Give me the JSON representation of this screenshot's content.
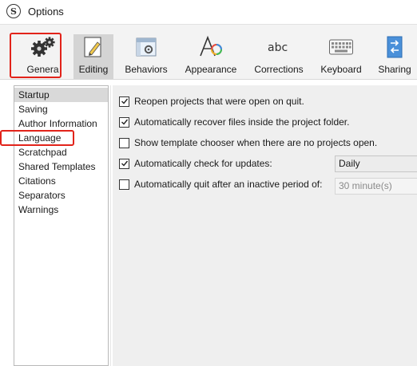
{
  "window": {
    "title": "Options",
    "app_icon_glyph": "S"
  },
  "toolbar": {
    "items": [
      {
        "label": "Genera",
        "icon": "gear-icon"
      },
      {
        "label": "Editing",
        "icon": "pencil-icon"
      },
      {
        "label": "Behaviors",
        "icon": "window-gear-icon"
      },
      {
        "label": "Appearance",
        "icon": "font-color-icon"
      },
      {
        "label": "Corrections",
        "icon": "abc-icon"
      },
      {
        "label": "Keyboard",
        "icon": "keyboard-icon"
      },
      {
        "label": "Sharing",
        "icon": "sharing-icon"
      }
    ]
  },
  "sidebar": {
    "items": [
      {
        "label": "Startup"
      },
      {
        "label": "Saving"
      },
      {
        "label": "Author Information"
      },
      {
        "label": "Language"
      },
      {
        "label": "Scratchpad"
      },
      {
        "label": "Shared Templates"
      },
      {
        "label": "Citations"
      },
      {
        "label": "Separators"
      },
      {
        "label": "Warnings"
      }
    ],
    "selected": "Startup"
  },
  "startup": {
    "options": [
      {
        "label": "Reopen projects that were open on quit.",
        "checked": true
      },
      {
        "label": "Automatically recover files inside the project folder.",
        "checked": true
      },
      {
        "label": "Show template chooser when there are no projects open.",
        "checked": false
      },
      {
        "label": "Automatically check for updates:",
        "checked": true
      },
      {
        "label": "Automatically quit after an inactive period of:",
        "checked": false
      }
    ],
    "update_frequency": "Daily",
    "quit_period": "30 minute(s)"
  },
  "colors": {
    "highlight": "#e2231a",
    "selected_bg": "#d4d4d4",
    "panel_bg": "#efefef"
  }
}
